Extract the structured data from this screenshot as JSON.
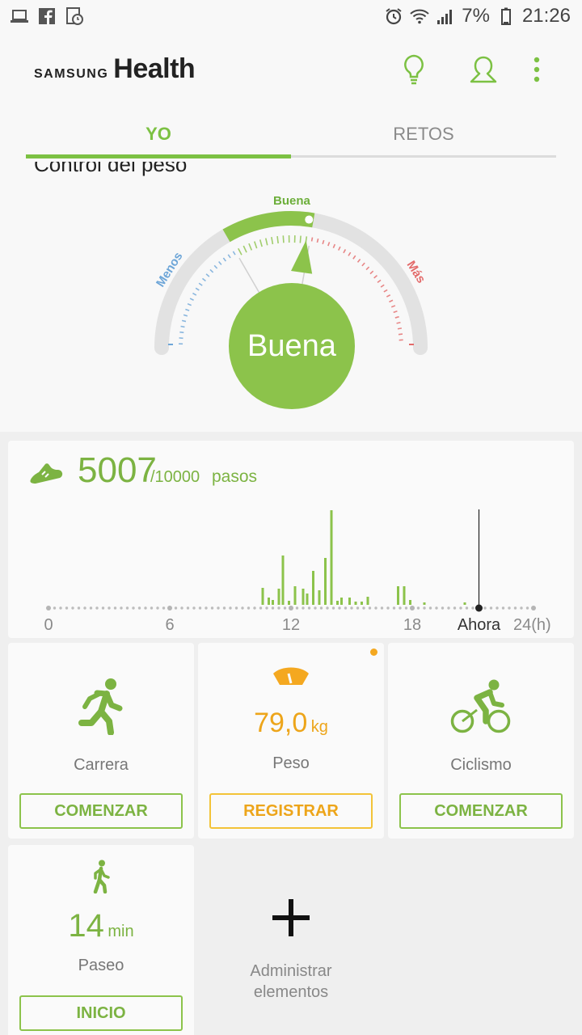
{
  "status_bar": {
    "battery": "7%",
    "time": "21:26"
  },
  "header": {
    "brand_small": "SAMSUNG",
    "brand_large": "Health"
  },
  "tabs": [
    {
      "label": "YO"
    },
    {
      "label": "RETOS"
    }
  ],
  "weight_control": {
    "title": "Control del peso",
    "status": "Buena",
    "zone_good": "Buena",
    "zone_less": "Menos",
    "zone_more": "Más"
  },
  "steps": {
    "count": "5007",
    "goal": "/10000",
    "unit": "pasos",
    "now_label": "Ahora",
    "x_ticks": [
      "0",
      "6",
      "12",
      "18",
      "24(h)"
    ],
    "chart_data": {
      "type": "bar",
      "xlabel": "",
      "ylabel": "",
      "xlim": [
        0,
        24
      ],
      "now_hour": 21.3,
      "hours": [
        10.6,
        10.9,
        11.1,
        11.4,
        11.6,
        11.9,
        12.2,
        12.6,
        12.8,
        13.1,
        13.4,
        13.7,
        14.0,
        14.3,
        14.5,
        14.9,
        15.2,
        15.5,
        15.8,
        17.3,
        17.6,
        17.9,
        18.6,
        20.6
      ],
      "values": [
        21,
        9,
        6,
        20,
        61,
        5,
        23,
        20,
        14,
        42,
        18,
        58,
        117,
        5,
        9,
        9,
        4,
        4,
        10,
        23,
        23,
        6,
        3,
        3
      ]
    }
  },
  "tiles": {
    "run": {
      "label": "Carrera",
      "button": "COMENZAR"
    },
    "weight": {
      "value": "79,0",
      "unit": "kg",
      "label": "Peso",
      "button": "REGISTRAR"
    },
    "bike": {
      "label": "Ciclismo",
      "button": "COMENZAR"
    },
    "walk": {
      "value": "14",
      "unit": "min",
      "label": "Paseo",
      "button": "INICIO"
    }
  },
  "manage": {
    "label": "Administrar\nelementos"
  },
  "colors": {
    "accent_green": "#8cc34b",
    "accent_orange": "#f4a820",
    "less_blue": "#6ea6d8",
    "more_red": "#e36a6a"
  }
}
